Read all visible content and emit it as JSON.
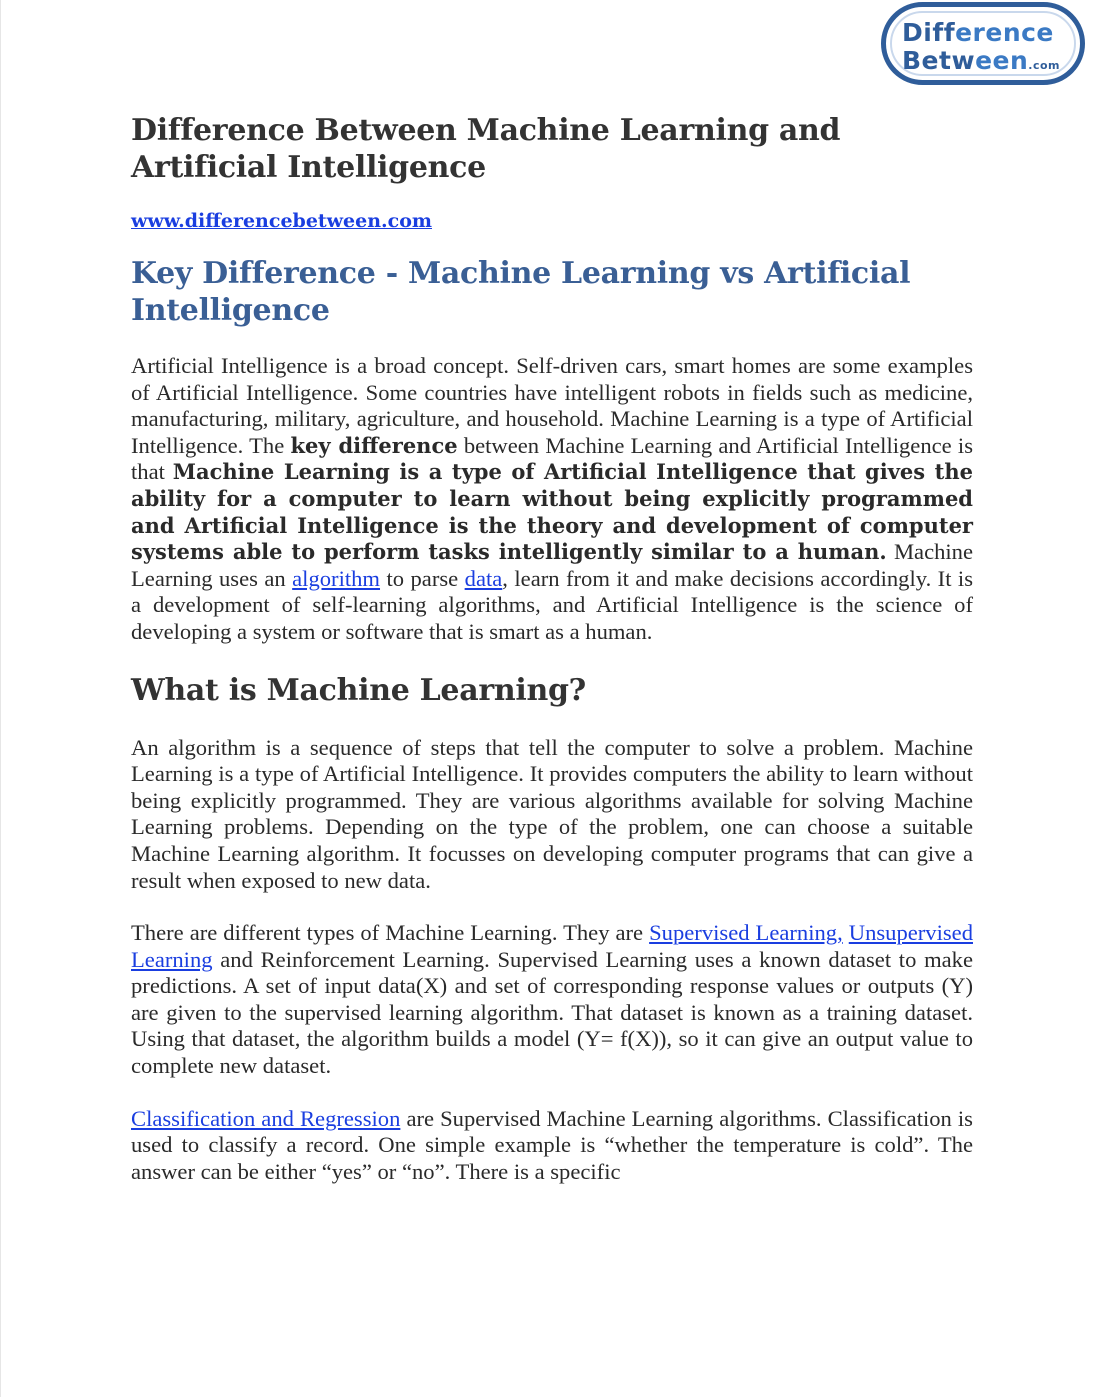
{
  "logo": {
    "line1_a": "Diff",
    "line1_b": "erence",
    "line2_a": "Betw",
    "line2_b": "een",
    "line2_c": ".com"
  },
  "title": "Difference Between Machine Learning and Artificial Intelligence",
  "site_url": "www.differencebetween.com",
  "key_heading": "Key Difference - Machine Learning vs Artificial Intelligence",
  "para1": {
    "t1": "Artificial Intelligence is a broad concept. Self-driven cars, smart homes are some examples of Artificial Intelligence. Some countries have intelligent robots in fields such as medicine, manufacturing, military, agriculture, and household. Machine Learning is a type of Artificial Intelligence. The ",
    "b1": "key difference",
    "t2": " between Machine Learning and Artificial Intelligence is that ",
    "b2": "Machine Learning is a type of Artificial Intelligence that gives the ability for a computer to learn without being explicitly programmed and Artificial Intelligence is the theory and development of computer systems able to perform tasks intelligently similar to a human.",
    "t3": " Machine Learning uses an ",
    "link_algorithm": "algorithm",
    "t4": " to parse ",
    "link_data": "data",
    "t5": ", learn from it and make decisions accordingly. It is a development of self-learning algorithms, and Artificial Intelligence is the science of developing a system or software that is smart as a human."
  },
  "what_heading": "What is Machine Learning?",
  "para2": "An algorithm is a sequence of steps that tell the computer to solve a problem. Machine Learning is a type of Artificial Intelligence. It provides computers the ability to learn without being explicitly programmed. They are various algorithms available for solving Machine Learning problems. Depending on the type of the problem, one can choose a suitable Machine Learning algorithm. It focusses on developing computer programs that can give a result when exposed to new data.",
  "para3": {
    "t1": "There are different types of Machine Learning. They are ",
    "link_supervised": "Supervised Learning,",
    "t2": " ",
    "link_unsupervised": "Unsupervised Learning",
    "t3": " and Reinforcement Learning. Supervised Learning uses a known dataset to make predictions. A set of input data(X) and set of corresponding response values or outputs (Y) are given to the supervised learning algorithm. That dataset is known as a training dataset. Using that dataset, the algorithm builds a model (Y= f(X)), so it can give an output value to complete new dataset."
  },
  "para4": {
    "link_classification": "Classification and Regression",
    "t1": " are Supervised Machine Learning algorithms. Classification is used to classify a record. One simple example is “whether the temperature is cold”. The answer can be either “yes” or “no”. There is a specific"
  }
}
